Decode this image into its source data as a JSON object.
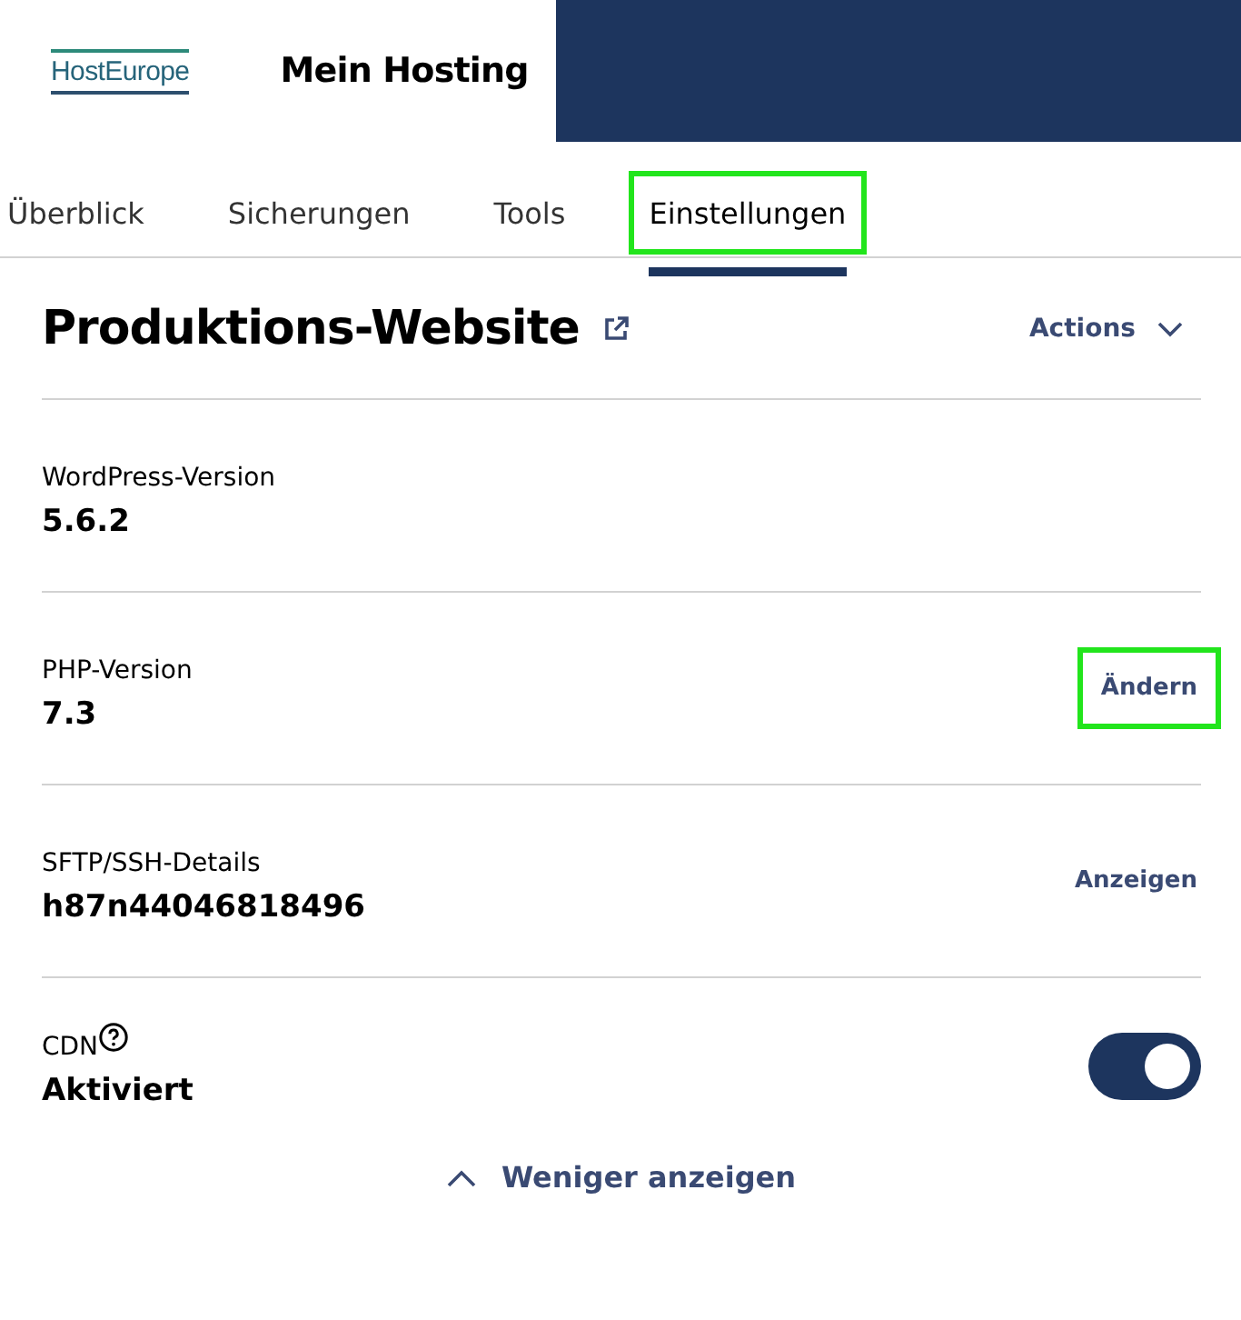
{
  "header": {
    "logo": "HostEurope",
    "title": "Mein Hosting"
  },
  "tabs": [
    {
      "label": "Überblick",
      "selected": false,
      "highlighted": false
    },
    {
      "label": "Sicherungen",
      "selected": false,
      "highlighted": false
    },
    {
      "label": "Tools",
      "selected": false,
      "highlighted": false
    },
    {
      "label": "Einstellungen",
      "selected": true,
      "highlighted": true
    }
  ],
  "site": {
    "title": "Produktions-Website",
    "actions": "Actions"
  },
  "rows": [
    {
      "kind": "plain",
      "label": "WordPress-Version",
      "value": "5.6.2"
    },
    {
      "kind": "action",
      "label": "PHP-Version",
      "value": "7.3",
      "action": "Ändern",
      "highlighted": true
    },
    {
      "kind": "action",
      "label": "SFTP/SSH-Details",
      "value": "h87n44046818496",
      "action": "Anzeigen",
      "highlighted": false
    },
    {
      "kind": "toggle",
      "label": "CDN",
      "value": "Aktiviert",
      "help": true,
      "on": true
    }
  ],
  "show_less": "Weniger anzeigen"
}
